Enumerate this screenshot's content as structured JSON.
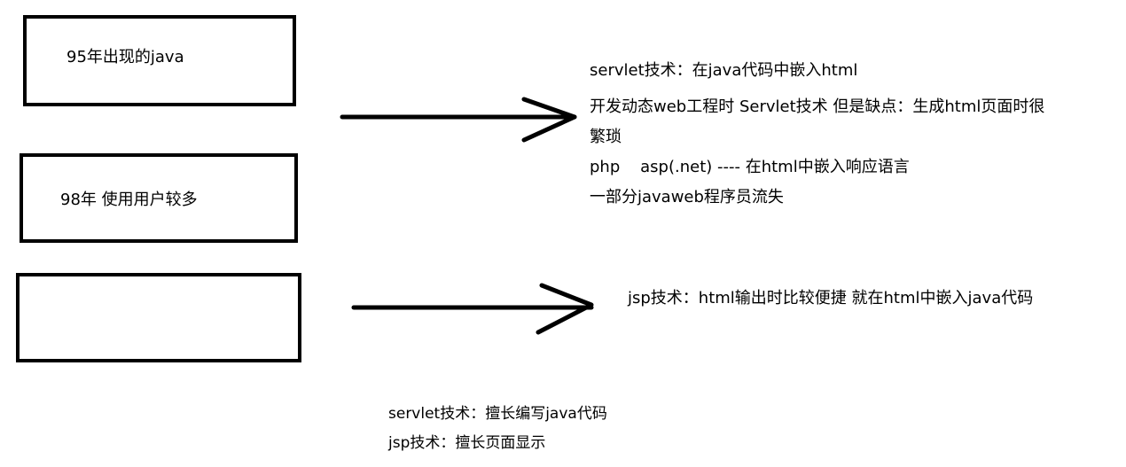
{
  "boxes": {
    "java95": "95年出现的java",
    "users98": "98年 使用用户较多",
    "empty": ""
  },
  "notes": {
    "servlet_title": "servlet技术：在java代码中嵌入html",
    "servlet_issue_line1": "开发动态web工程时 Servlet技术 但是缺点：生成html页面时很",
    "servlet_issue_line2": "繁琐",
    "php_asp": "php    asp(.net) ---- 在html中嵌入响应语言",
    "loss": "一部分javaweb程序员流失",
    "jsp_desc": "jsp技术：html输出时比较便捷 就在html中嵌入java代码"
  },
  "summary": {
    "servlet": "servlet技术：擅长编写java代码",
    "jsp": "jsp技术：擅长页面显示"
  }
}
